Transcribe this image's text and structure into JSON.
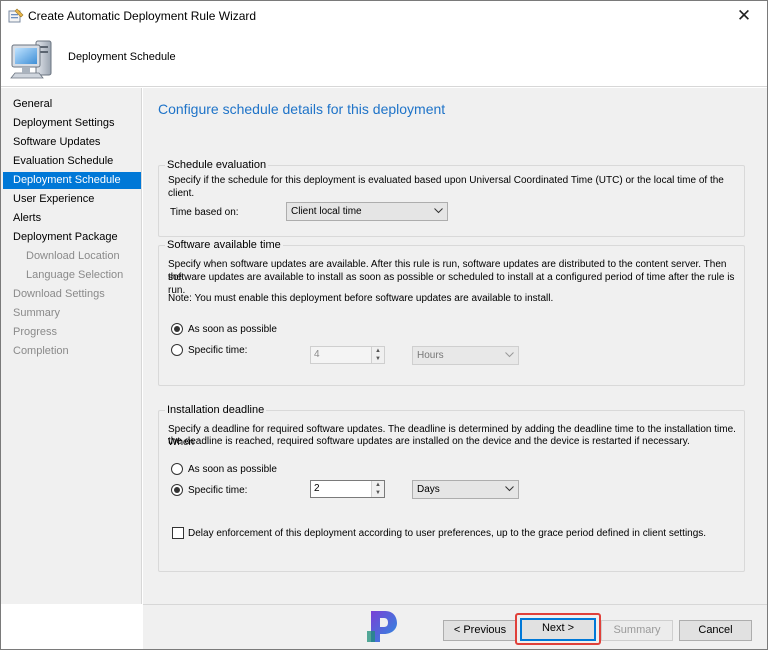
{
  "window": {
    "title": "Create Automatic Deployment Rule Wizard",
    "close_glyph": "✕"
  },
  "header": {
    "title": "Deployment Schedule"
  },
  "sidebar": {
    "items": [
      {
        "label": "General",
        "state": "normal"
      },
      {
        "label": "Deployment Settings",
        "state": "normal"
      },
      {
        "label": "Software Updates",
        "state": "normal"
      },
      {
        "label": "Evaluation Schedule",
        "state": "normal"
      },
      {
        "label": "Deployment Schedule",
        "state": "active"
      },
      {
        "label": "User Experience",
        "state": "normal"
      },
      {
        "label": "Alerts",
        "state": "normal"
      },
      {
        "label": "Deployment Package",
        "state": "normal"
      },
      {
        "label": "Download Location",
        "state": "disabled-sub"
      },
      {
        "label": "Language Selection",
        "state": "disabled-sub"
      },
      {
        "label": "Download Settings",
        "state": "disabled"
      },
      {
        "label": "Summary",
        "state": "disabled"
      },
      {
        "label": "Progress",
        "state": "disabled"
      },
      {
        "label": "Completion",
        "state": "disabled"
      }
    ]
  },
  "main": {
    "heading": "Configure schedule details for this deployment",
    "schedule_evaluation": {
      "title": "Schedule evaluation",
      "description": "Specify if the schedule for this deployment is evaluated based upon Universal Coordinated Time (UTC) or the local time of the client.",
      "time_based_label": "Time based on:",
      "time_based_value": "Client local time"
    },
    "available_time": {
      "title": "Software available time",
      "description_1": "Specify when software updates are available. After this rule is run, software updates are distributed to the content server. Then the",
      "description_2": "software updates are available to install as soon as possible or scheduled to install at a configured period of time after the rule is run.",
      "note": "Note: You must enable this deployment before software updates are available to install.",
      "option_asap": "As soon as possible",
      "option_specific": "Specific time:",
      "selected": "asap",
      "specific_value": "4",
      "specific_unit": "Hours"
    },
    "deadline": {
      "title": "Installation deadline",
      "description_1": "Specify a deadline for required software updates. The deadline is determined by adding the deadline time to the installation time. When",
      "description_2": "the deadline is reached, required software updates are installed on the device and the device is restarted if necessary.",
      "option_asap": "As soon as possible",
      "option_specific": "Specific time:",
      "selected": "specific",
      "specific_value": "2",
      "specific_unit": "Days",
      "delay_label": "Delay enforcement of this deployment according to user preferences, up to the grace period defined in client settings.",
      "delay_checked": false
    }
  },
  "footer": {
    "previous_label": "< Previous",
    "next_label": "Next >",
    "summary_label": "Summary",
    "cancel_label": "Cancel"
  },
  "colors": {
    "accent": "#0078d7",
    "heading": "#1e73c8",
    "highlight": "#e0403a"
  }
}
